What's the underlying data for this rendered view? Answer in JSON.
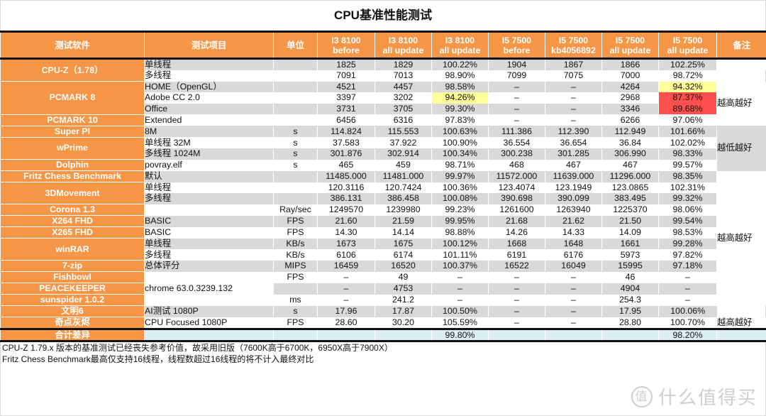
{
  "title": "CPU基准性能测试",
  "headers": [
    "测试软件",
    "测试项目",
    "单位",
    "I3 8100\nbefore",
    "I3 8100\nall update",
    "I3 8100\nall update",
    "I5 7500\nbefore",
    "I5 7500\nkb4056892",
    "I5 7500\nall update",
    "I5 7500\nall update",
    "备注"
  ],
  "header_lines": [
    [
      "测试软件"
    ],
    [
      "测试项目"
    ],
    [
      "单位"
    ],
    [
      "I3 8100",
      "before"
    ],
    [
      "I3 8100",
      "all update"
    ],
    [
      "I3 8100",
      "all update"
    ],
    [
      "I5 7500",
      "before"
    ],
    [
      "I5 7500",
      "kb4056892"
    ],
    [
      "I5 7500",
      "all update"
    ],
    [
      "I5 7500",
      "all update"
    ],
    [
      "备注"
    ]
  ],
  "rows": [
    {
      "software": "CPU-Z（1.78）",
      "software_span": 2,
      "item": "单线程",
      "unit": "",
      "v": [
        "1825",
        "1829",
        "100.22%",
        "1904",
        "1867",
        "1866",
        "102.25%"
      ],
      "note": "",
      "note_span": 1
    },
    {
      "item": "多线程",
      "unit": "",
      "v": [
        "7091",
        "7013",
        "98.90%",
        "7099",
        "7075",
        "7000",
        "98.72%"
      ]
    },
    {
      "software": "PCMARK 8",
      "software_span": 3,
      "item": "HOME（OpenGL）",
      "unit": "",
      "v": [
        "4521",
        "4457",
        "98.58%",
        "–",
        "–",
        "4264",
        "94.32%"
      ],
      "hl": {
        "6": "yellow"
      },
      "note": "越高越好",
      "note_span": 4
    },
    {
      "item": "Adobe CC 2.0",
      "unit": "",
      "v": [
        "3397",
        "3202",
        "94.26%",
        "–",
        "–",
        "2968",
        "87.37%"
      ],
      "hl": {
        "2": "yellow",
        "6": "red"
      }
    },
    {
      "item": "Office",
      "unit": "",
      "v": [
        "3731",
        "3705",
        "99.30%",
        "–",
        "–",
        "3346",
        "89.68%"
      ],
      "hl": {
        "6": "red"
      }
    },
    {
      "software": "PCMARK 10",
      "software_span": 1,
      "item": "Extended",
      "unit": "",
      "v": [
        "6456",
        "6316",
        "97.83%",
        "–",
        "–",
        "6266",
        "97.06%"
      ]
    },
    {
      "software": "Super PI",
      "software_span": 1,
      "item": "8M",
      "unit": "s",
      "v": [
        "114.824",
        "115.553",
        "100.63%",
        "111.386",
        "112.390",
        "112.949",
        "101.66%"
      ],
      "note": "越低越好",
      "note_span": 4,
      "note_gray": true
    },
    {
      "software": "wPrime",
      "software_span": 2,
      "item": "单线程 32M",
      "unit": "s",
      "v": [
        "37.583",
        "37.922",
        "100.90%",
        "36.554",
        "36.654",
        "36.84",
        "102.02%"
      ]
    },
    {
      "item": "多线程 1024M",
      "unit": "s",
      "v": [
        "301.876",
        "302.914",
        "100.34%",
        "300.238",
        "301.285",
        "306.990",
        "98.33%"
      ]
    },
    {
      "software": "Dolphin",
      "software_span": 1,
      "item": "povray.elf",
      "unit": "s",
      "v": [
        "465",
        "459",
        "98.71%",
        "468",
        "467",
        "467",
        "99.57%"
      ]
    },
    {
      "software": "Fritz Chess Benchmark",
      "software_span": 1,
      "item": "默认",
      "unit": "",
      "v": [
        "11485.000",
        "11481.000",
        "99.97%",
        "11572.000",
        "11639.000",
        "11296.000",
        "98.35%"
      ],
      "note": "越高越好",
      "note_span": 12
    },
    {
      "software": "3DMovement",
      "software_span": 2,
      "item": "单线程",
      "unit": "",
      "v": [
        "120.3116",
        "120.7424",
        "100.36%",
        "123.4074",
        "123.1949",
        "123.0865",
        "102.31%"
      ]
    },
    {
      "item": "多线程",
      "unit": "",
      "v": [
        "386.131",
        "386.458",
        "100.08%",
        "390.698",
        "390.099",
        "383.495",
        "99.32%"
      ]
    },
    {
      "software": "Corona 1.3",
      "software_span": 1,
      "item": "",
      "unit": "Ray/sec",
      "v": [
        "1249570",
        "1239980",
        "99.23%",
        "1261600",
        "1263940",
        "1225370",
        "98.06%"
      ]
    },
    {
      "software": "X264 FHD",
      "software_span": 1,
      "item": "BASIC",
      "unit": "FPS",
      "v": [
        "21.60",
        "21.59",
        "99.95%",
        "21.68",
        "21.62",
        "21.50",
        "99.54%"
      ]
    },
    {
      "software": "X265 FHD",
      "software_span": 1,
      "item": "BASIC",
      "unit": "FPS",
      "v": [
        "14.30",
        "14.14",
        "98.88%",
        "14.26",
        "14.33",
        "14.09",
        "98.53%"
      ]
    },
    {
      "software": "winRAR",
      "software_span": 2,
      "item": "单线程",
      "unit": "KB/s",
      "v": [
        "1673",
        "1675",
        "100.12%",
        "1668",
        "1648",
        "1661",
        "99.28%"
      ]
    },
    {
      "item": "多线程",
      "unit": "KB/s",
      "v": [
        "6106",
        "6174",
        "101.11%",
        "6191",
        "6176",
        "5973",
        "97.82%"
      ]
    },
    {
      "software": "7-zip",
      "software_span": 1,
      "item": "总体评分",
      "unit": "MIPS",
      "v": [
        "16459",
        "16520",
        "100.37%",
        "16522",
        "16049",
        "15995",
        "97.18%"
      ]
    },
    {
      "software": "Fishbowl",
      "software_span": 1,
      "item": "chrome 63.0.3239.132",
      "item_span": 3,
      "unit": "FPS",
      "v": [
        "–",
        "49",
        "–",
        "–",
        "–",
        "46",
        "–"
      ]
    },
    {
      "software": "PEACEKEEPER",
      "software_span": 1,
      "unit": "",
      "v": [
        "–",
        "4753",
        "–",
        "–",
        "–",
        "4904",
        "–"
      ]
    },
    {
      "software": "sunspider 1.0.2",
      "software_span": 1,
      "unit": "ms",
      "v": [
        "–",
        "241.2",
        "–",
        "–",
        "–",
        "254.3",
        "–"
      ],
      "note": "越低越好",
      "note_span": 2,
      "note_gray": true
    },
    {
      "software": "文明6",
      "software_span": 1,
      "item": "AI测试 1080P",
      "unit": "s",
      "v": [
        "17.96",
        "17.87",
        "100.50%",
        "–",
        "–",
        "17.95",
        "100.06%"
      ]
    },
    {
      "software": "奇点灰烬",
      "software_span": 1,
      "item": "CPU Focused 1080P",
      "unit": "FPS",
      "v": [
        "28.60",
        "30.20",
        "105.59%",
        "–",
        "–",
        "28.80",
        "100.70%"
      ],
      "note": "越高越好",
      "note_span": 1
    }
  ],
  "total": {
    "label": "合计差异",
    "i3_ratio": "99.80%",
    "i5_ratio": "98.20%"
  },
  "highlight_colors": {
    "yellow": "#ffff99",
    "red": "#ff5050",
    "header": "#f79646",
    "row_gray": "#d9d9d9",
    "total_bg": "#daeef3"
  },
  "footnotes": [
    "CPU-Z 1.79.x 版本的基准测试已经丧失参考价值，故采用旧版（7600K高于6700K，6950X高于7900X）",
    "Fritz Chess Benchmark最高仅支持16线程，线程数超过16线程的将不计入最终对比"
  ],
  "watermark": {
    "badge": "值",
    "text": "什么值得买"
  }
}
